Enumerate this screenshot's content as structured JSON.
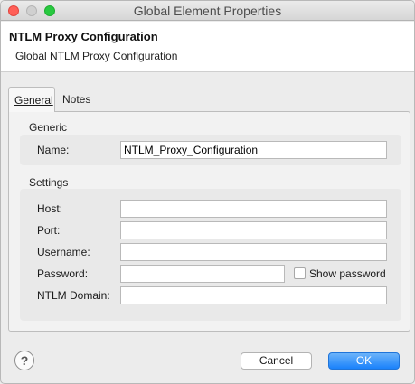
{
  "window": {
    "title": "Global Element Properties"
  },
  "header": {
    "title": "NTLM Proxy Configuration",
    "subtitle": "Global NTLM Proxy Configuration"
  },
  "tabs": [
    {
      "label": "General",
      "selected": true
    },
    {
      "label": "Notes",
      "selected": false
    }
  ],
  "generic": {
    "section_label": "Generic",
    "name_label": "Name:",
    "name_value": "NTLM_Proxy_Configuration"
  },
  "settings": {
    "section_label": "Settings",
    "host_label": "Host:",
    "host_value": "",
    "port_label": "Port:",
    "port_value": "",
    "username_label": "Username:",
    "username_value": "",
    "password_label": "Password:",
    "password_value": "",
    "show_password_label": "Show password",
    "show_password_checked": false,
    "domain_label": "NTLM Domain:",
    "domain_value": ""
  },
  "footer": {
    "help_symbol": "?",
    "cancel_label": "Cancel",
    "ok_label": "OK"
  },
  "colors": {
    "ok_button": "#1a82fb",
    "close_light": "#ff5f57",
    "maximize_light": "#28c940"
  }
}
